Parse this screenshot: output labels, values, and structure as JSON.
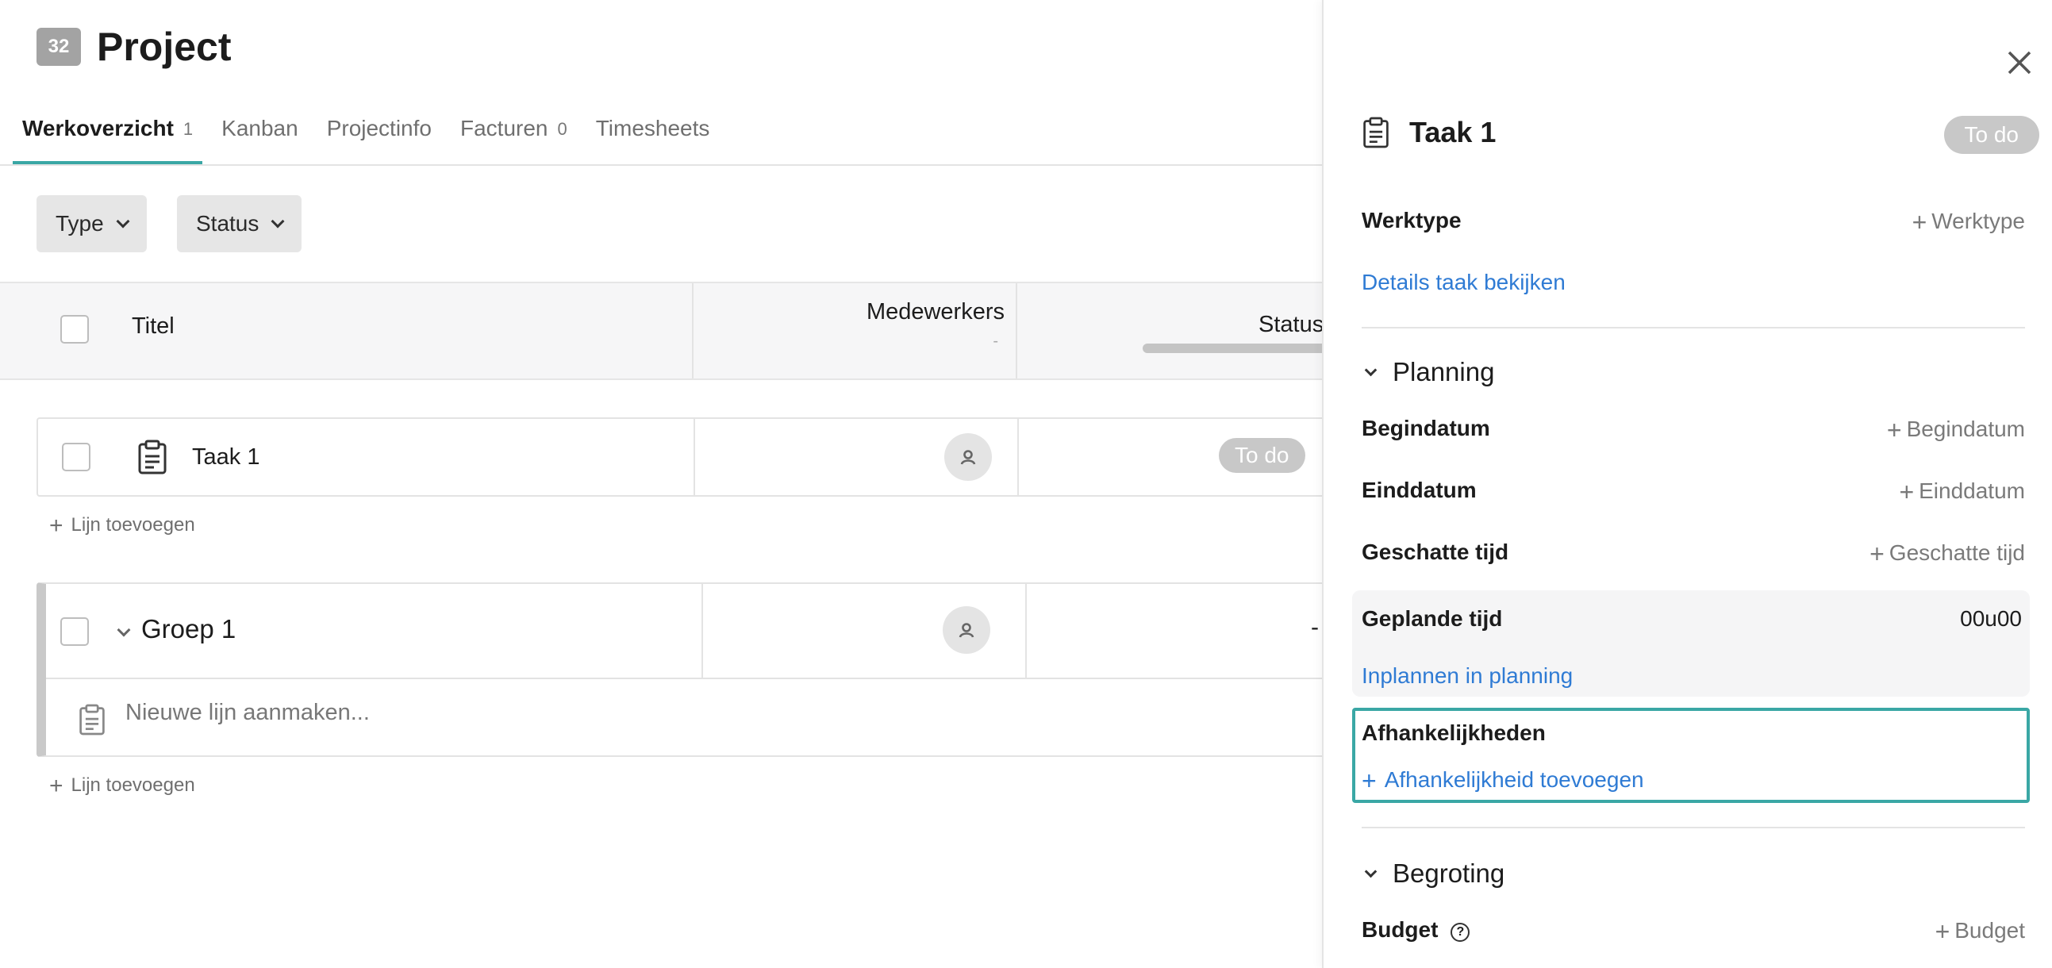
{
  "project": {
    "badge": "32",
    "title": "Project"
  },
  "tabs": [
    {
      "label": "Werkoverzicht",
      "count": "1",
      "active": true
    },
    {
      "label": "Kanban",
      "count": ""
    },
    {
      "label": "Projectinfo",
      "count": ""
    },
    {
      "label": "Facturen",
      "count": "0"
    },
    {
      "label": "Timesheets",
      "count": ""
    }
  ],
  "filters": {
    "type_label": "Type",
    "status_label": "Status"
  },
  "table": {
    "headers": {
      "title": "Titel",
      "medewerkers": "Medewerkers",
      "medewerkers_sub": "-",
      "status": "Status"
    },
    "rows": [
      {
        "title": "Taak 1",
        "status": "To do"
      }
    ],
    "add_line_label": "Lijn toevoegen",
    "group": {
      "name": "Groep 1",
      "status": "-",
      "new_line_placeholder": "Nieuwe lijn aanmaken..."
    }
  },
  "panel": {
    "title": "Taak 1",
    "status": "To do",
    "werktype": {
      "label": "Werktype",
      "action": "Werktype"
    },
    "details_link": "Details taak bekijken",
    "planning": {
      "section": "Planning",
      "begindatum": {
        "label": "Begindatum",
        "action": "Begindatum"
      },
      "einddatum": {
        "label": "Einddatum",
        "action": "Einddatum"
      },
      "geschatte_tijd": {
        "label": "Geschatte tijd",
        "action": "Geschatte tijd"
      },
      "geplande_tijd": {
        "label": "Geplande tijd",
        "value": "00u00"
      },
      "inplannen_link": "Inplannen in planning"
    },
    "afhankelijkheden": {
      "label": "Afhankelijkheden",
      "add_link": "Afhankelijkheid toevoegen"
    },
    "begroting": {
      "section": "Begroting",
      "budget": {
        "label": "Budget",
        "action": "Budget",
        "help": "?"
      }
    }
  },
  "colors": {
    "accent": "#3aa7a5",
    "link": "#2f7bd4",
    "pill": "#c8c8c8"
  }
}
